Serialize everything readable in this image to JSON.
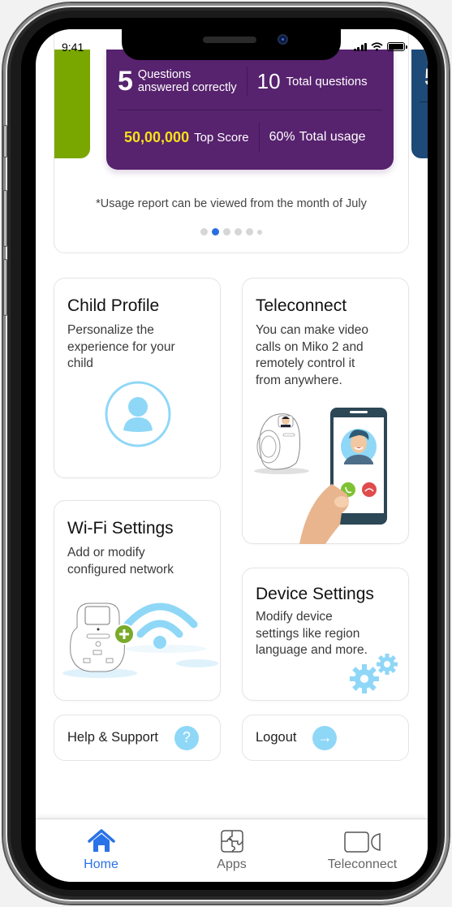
{
  "status_bar": {
    "time": "9:41"
  },
  "usage_carousel": {
    "active_slide": {
      "correct_count": "5",
      "correct_label_line1": "Questions",
      "correct_label_line2": "answered correctly",
      "total_count": "10",
      "total_label": "Total questions",
      "top_score": "50,00,000",
      "top_score_label": "Top Score",
      "usage_value": "60%",
      "usage_label": "Total usage"
    },
    "next_slide_preview": {
      "count": "5"
    },
    "slide_colors": {
      "previous": "#7aa600",
      "active": "#57226e",
      "next": "#1e4a78"
    },
    "note": "*Usage report can be viewed from the month of July",
    "page_count": 6,
    "active_page": 2
  },
  "cards": {
    "child_profile": {
      "title": "Child Profile",
      "desc_lines": [
        "Personalize the",
        "experience for your",
        "child"
      ],
      "icon": "user-circle-icon"
    },
    "teleconnect": {
      "title": "Teleconnect",
      "desc_lines": [
        "You can make video",
        "calls on Miko 2 and",
        "remotely control it",
        "from anywhere."
      ],
      "icon": "video-call-illustration"
    },
    "wifi_settings": {
      "title": "Wi-Fi Settings",
      "desc_lines": [
        "Add or modify",
        "configured network"
      ],
      "icon": "robot-wifi-illustration"
    },
    "device_settings": {
      "title": "Device Settings",
      "desc_lines": [
        "Modify device",
        "settings like region",
        "language and more."
      ],
      "icon": "gears-icon"
    }
  },
  "links": {
    "help": {
      "label": "Help & Support",
      "icon_glyph": "?"
    },
    "logout": {
      "label": "Logout",
      "icon_glyph": "→"
    }
  },
  "tabbar": {
    "items": [
      {
        "label": "Home",
        "icon": "home-icon",
        "active": true
      },
      {
        "label": "Apps",
        "icon": "puzzle-icon",
        "active": false
      },
      {
        "label": "Teleconnect",
        "icon": "video-camera-icon",
        "active": false
      }
    ],
    "active_color": "#2a72e8"
  },
  "accent_colors": {
    "light_blue": "#8fd7f7",
    "score_yellow": "#f6e01a"
  }
}
